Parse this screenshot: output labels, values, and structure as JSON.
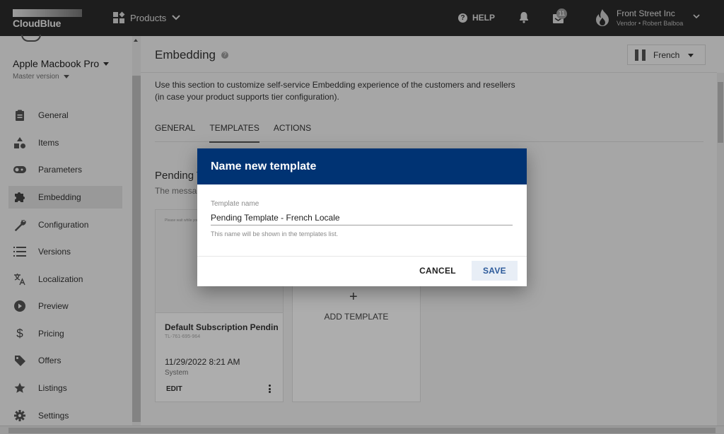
{
  "topbar": {
    "brand": "CloudBlue",
    "products_label": "Products",
    "help_label": "HELP",
    "notifications_count": "11",
    "account_name": "Front Street Inc",
    "account_sub": "Vendor • Robert Balboa"
  },
  "sidebar": {
    "product_name": "Apple Macbook Pro",
    "version": "Master version",
    "items": [
      {
        "label": "General",
        "icon": "clipboard-icon"
      },
      {
        "label": "Items",
        "icon": "shapes-icon"
      },
      {
        "label": "Parameters",
        "icon": "toggle-icon"
      },
      {
        "label": "Embedding",
        "icon": "puzzle-icon",
        "active": true
      },
      {
        "label": "Configuration",
        "icon": "wrench-icon"
      },
      {
        "label": "Versions",
        "icon": "list-icon"
      },
      {
        "label": "Localization",
        "icon": "translate-icon"
      },
      {
        "label": "Preview",
        "icon": "play-icon"
      },
      {
        "label": "Pricing",
        "icon": "dollar-icon"
      },
      {
        "label": "Offers",
        "icon": "tag-icon"
      },
      {
        "label": "Listings",
        "icon": "star-icon"
      },
      {
        "label": "Settings",
        "icon": "gear-icon"
      }
    ]
  },
  "main": {
    "title": "Embedding",
    "language": "French",
    "description_line1": "Use this section to customize self-service Embedding experience of the customers and resellers",
    "description_line2": "(in case your product supports tier configuration).",
    "tabs": [
      {
        "label": "GENERAL"
      },
      {
        "label": "TEMPLATES",
        "active": true
      },
      {
        "label": "ACTIONS"
      }
    ],
    "section_title": "Pending T",
    "section_subtitle": "The messag",
    "card": {
      "preview_text": "Please wait while your",
      "title": "Default Subscription Pendin...",
      "id": "TL-761-695-964",
      "date": "11/29/2022 8:21 AM",
      "author": "System",
      "edit_label": "EDIT"
    },
    "add_template_label": "ADD TEMPLATE"
  },
  "dialog": {
    "title": "Name new template",
    "field_label": "Template name",
    "field_value": "Pending Template - French Locale",
    "field_hint": "This name will be shown in the templates list.",
    "cancel_label": "CANCEL",
    "save_label": "SAVE"
  },
  "colors": {
    "dialog_header": "#003373",
    "topbar": "#2c2c2c",
    "save_text": "#2c5a9a"
  }
}
